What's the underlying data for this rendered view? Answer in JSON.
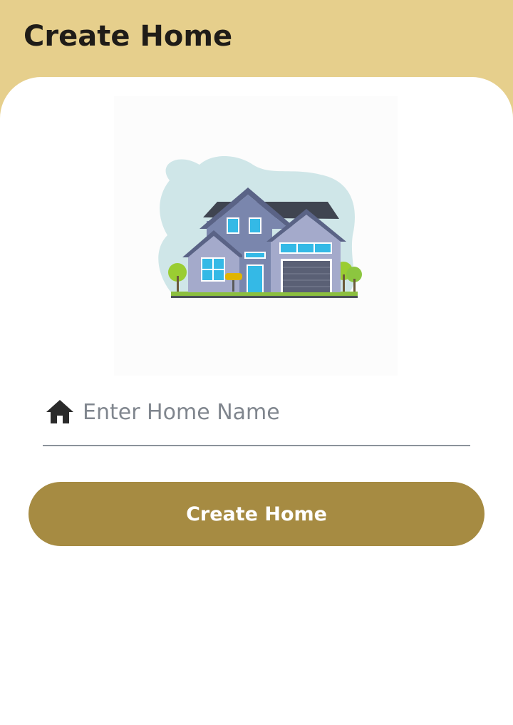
{
  "header": {
    "title": "Create Home"
  },
  "form": {
    "home_name_placeholder": "Enter Home Name",
    "home_name_value": ""
  },
  "actions": {
    "create_label": "Create Home"
  },
  "icons": {
    "input_icon": "home-icon",
    "illustration": "house-illustration"
  },
  "colors": {
    "header_bg": "#e6cf8c",
    "button_bg": "#a68b42",
    "button_text": "#ffffff"
  }
}
